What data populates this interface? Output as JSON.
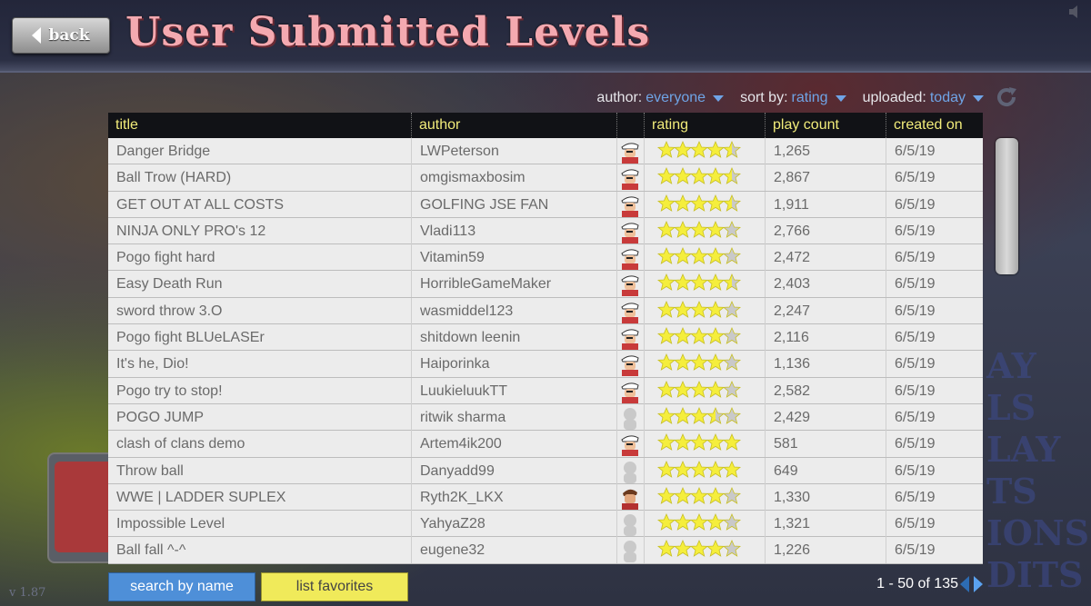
{
  "header": {
    "back_label": "back",
    "title": "User Submitted Levels"
  },
  "filters": [
    {
      "label": "author:",
      "value": "everyone"
    },
    {
      "label": "sort by:",
      "value": "rating"
    },
    {
      "label": "uploaded:",
      "value": "today"
    }
  ],
  "table": {
    "columns": [
      "title",
      "author",
      "",
      "rating",
      "play count",
      "created on"
    ],
    "rows": [
      {
        "title": "Danger Bridge",
        "author": "LWPeterson",
        "avatar": "white-cap-guy",
        "rating": 4.5,
        "plays": "1,265",
        "created": "6/5/19"
      },
      {
        "title": "Ball Trow (HARD)",
        "author": "omgismaxbosim",
        "avatar": "white-cap-guy",
        "rating": 4.5,
        "plays": "2,867",
        "created": "6/5/19"
      },
      {
        "title": "GET OUT AT ALL COSTS",
        "author": "GOLFING JSE FAN",
        "avatar": "white-cap-guy",
        "rating": 4.5,
        "plays": "1,911",
        "created": "6/5/19"
      },
      {
        "title": "NINJA ONLY PRO's 12",
        "author": "Vladi113",
        "avatar": "white-cap-guy",
        "rating": 4,
        "plays": "2,766",
        "created": "6/5/19"
      },
      {
        "title": "Pogo fight hard",
        "author": "Vitamin59",
        "avatar": "white-cap-guy",
        "rating": 4,
        "plays": "2,472",
        "created": "6/5/19"
      },
      {
        "title": "Easy Death Run",
        "author": "HorribleGameMaker",
        "avatar": "white-cap-guy",
        "rating": 4.5,
        "plays": "2,403",
        "created": "6/5/19"
      },
      {
        "title": "sword throw 3.O",
        "author": "wasmiddel123",
        "avatar": "white-cap-guy",
        "rating": 4,
        "plays": "2,247",
        "created": "6/5/19"
      },
      {
        "title": "Pogo fight BLUeLASEr",
        "author": "shitdown leenin",
        "avatar": "white-cap-guy",
        "rating": 4,
        "plays": "2,116",
        "created": "6/5/19"
      },
      {
        "title": "It's he, Dio!",
        "author": "Haiporinka",
        "avatar": "white-cap-guy",
        "rating": 4,
        "plays": "1,136",
        "created": "6/5/19"
      },
      {
        "title": "Pogo try to stop!",
        "author": "LuukieluukTT",
        "avatar": "white-cap-guy",
        "rating": 4,
        "plays": "2,582",
        "created": "6/5/19"
      },
      {
        "title": "POGO JUMP",
        "author": "ritwik sharma",
        "avatar": "grey-silhouette",
        "rating": 3.5,
        "plays": "2,429",
        "created": "6/5/19"
      },
      {
        "title": "clash of clans demo",
        "author": "Artem4ik200",
        "avatar": "white-cap-guy",
        "rating": 5,
        "plays": "581",
        "created": "6/5/19"
      },
      {
        "title": "Throw ball",
        "author": "Danyadd99",
        "avatar": "grey-silhouette",
        "rating": 5,
        "plays": "649",
        "created": "6/5/19"
      },
      {
        "title": "WWE | LADDER SUPLEX",
        "author": "Ryth2K_LKX",
        "avatar": "brown-hair-guy",
        "rating": 4,
        "plays": "1,330",
        "created": "6/5/19"
      },
      {
        "title": "Impossible Level",
        "author": "YahyaZ28",
        "avatar": "grey-silhouette",
        "rating": 4,
        "plays": "1,321",
        "created": "6/5/19"
      },
      {
        "title": "Ball fall ^-^",
        "author": "eugene32",
        "avatar": "grey-silhouette",
        "rating": 4,
        "plays": "1,226",
        "created": "6/5/19"
      }
    ]
  },
  "footer": {
    "search_label": "search by name",
    "favorites_label": "list favorites",
    "pagination": "1 - 50 of 135",
    "version": "v 1.87"
  },
  "colors": {
    "title_pink": "#f4a9b0",
    "header_text_yellow": "#f2ec7a",
    "filter_value_blue": "#6fa4e6",
    "search_button_blue": "#4e8fd8",
    "favorites_button_yellow": "#f0ea5a"
  }
}
